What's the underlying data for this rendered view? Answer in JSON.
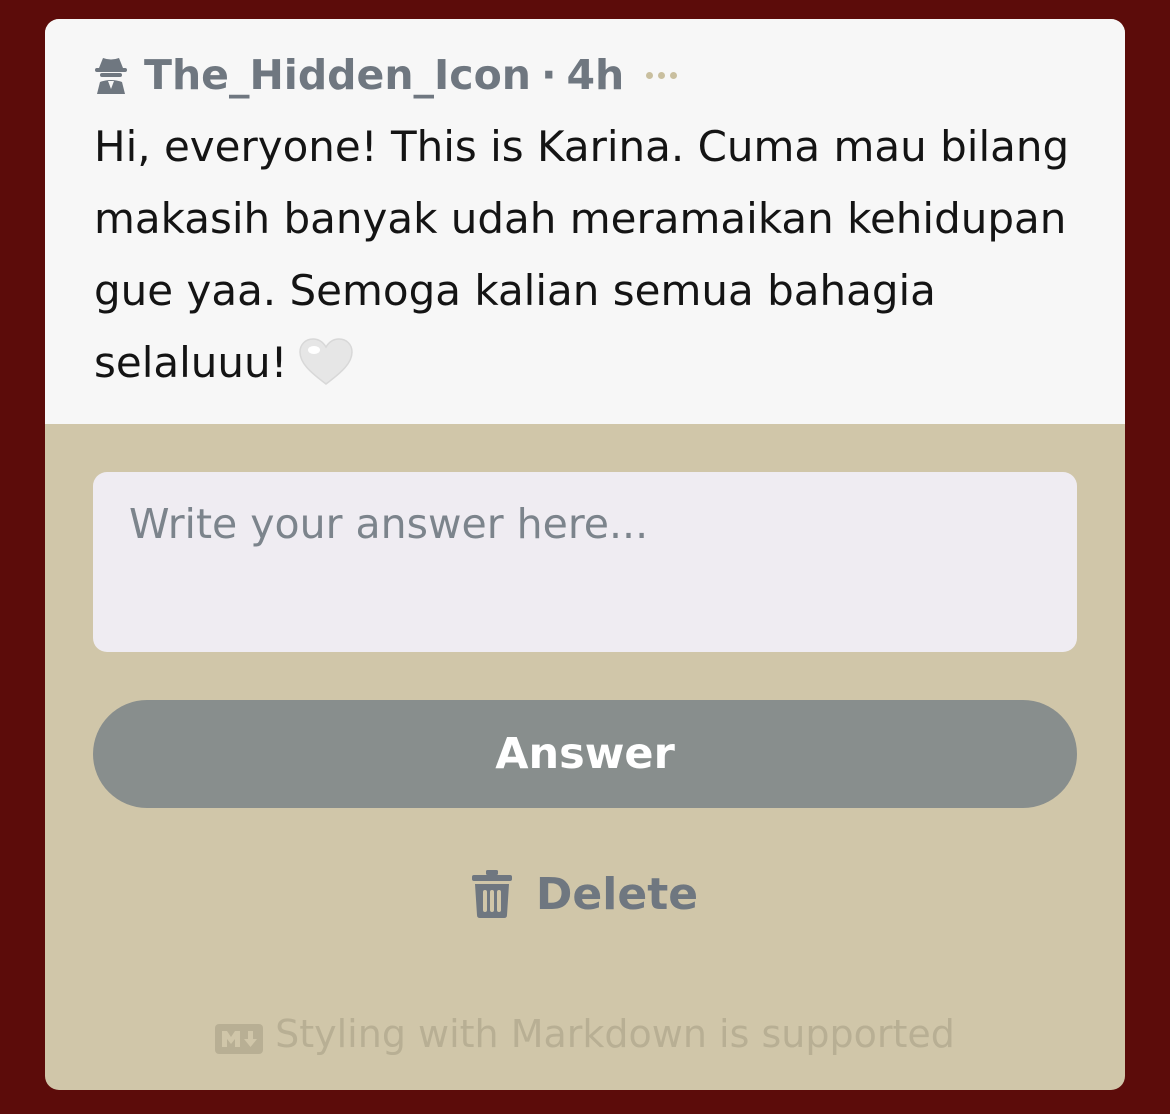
{
  "question": {
    "author": "The_Hidden_Icon",
    "separator": "·",
    "age": "4h",
    "text": "Hi, everyone! This is Karina. Cuma mau bilang makasih banyak udah meramaikan kehidupan gue yaa. Semoga kalian semua bahagia selaluuu!",
    "author_icon": "spy-icon",
    "emoji_icon": "white-heart-icon"
  },
  "answer": {
    "placeholder": "Write your answer here...",
    "value": "",
    "submit_label": "Answer"
  },
  "delete": {
    "label": "Delete",
    "icon": "trash-icon"
  },
  "footer": {
    "markdown_note": "Styling with Markdown is supported",
    "icon": "markdown-icon"
  },
  "colors": {
    "background": "#5c0c0a",
    "card": "#d0c6a9",
    "question_bg": "#f7f7f7",
    "button": "#888e8d",
    "muted_text": "#6f7780"
  }
}
